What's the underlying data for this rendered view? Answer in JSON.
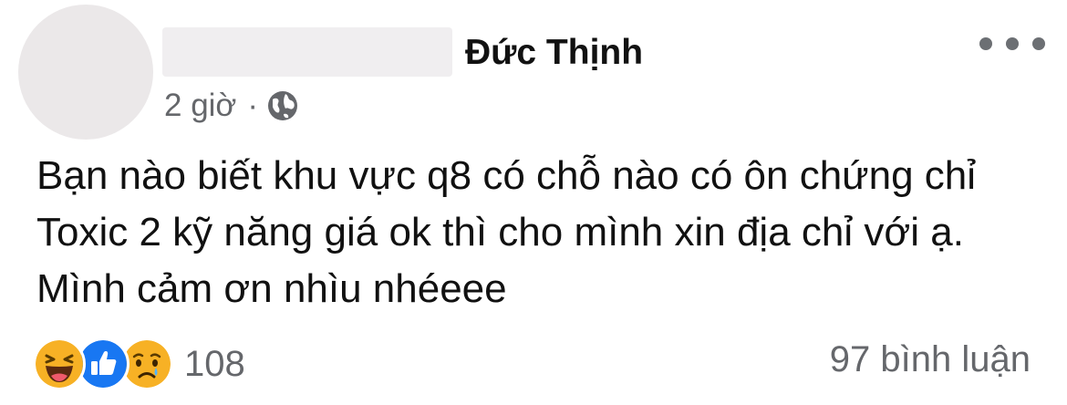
{
  "post": {
    "author": "Đức Thịnh",
    "timestamp": "2 giờ",
    "separator": "·",
    "privacy_icon": "globe-icon",
    "menu_icon": "more-options-icon",
    "body_lines": [
      "Bạn nào biết khu vực q8 có chỗ nào có ôn chứng chỉ",
      "Toxic 2 kỹ năng giá ok thì cho mình xin địa chỉ với ạ.",
      "Mình cảm ơn nhìu nhéeee"
    ]
  },
  "footer": {
    "reaction_icons": [
      "haha-reaction-icon",
      "like-reaction-icon",
      "sad-reaction-icon"
    ],
    "reaction_count": "108",
    "comment_count": "97 bình luận"
  },
  "colors": {
    "secondary_text": "#65676b",
    "like_blue": "#1877f2",
    "emoji_yellow": "#f7b125"
  }
}
